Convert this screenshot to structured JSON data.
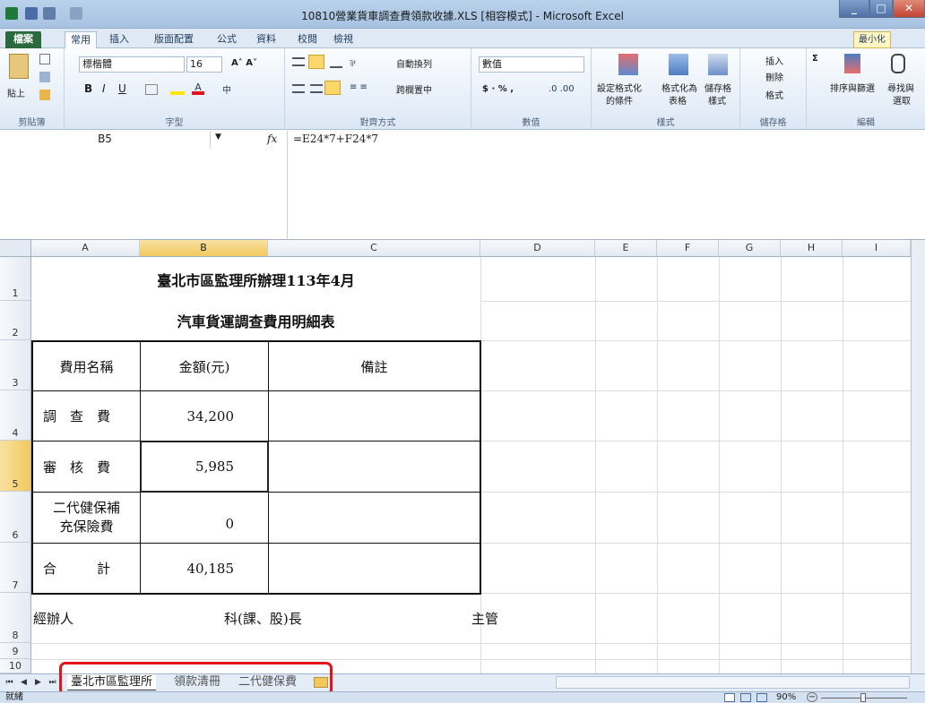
{
  "window": {
    "title": "10810營業貨車調查費領款收據.XLS [相容模式] - Microsoft Excel"
  },
  "tabs": {
    "file": "檔案",
    "home": "常用",
    "insert": "插入",
    "layout": "版面配置",
    "formulas": "公式",
    "data": "資料",
    "review": "校閱",
    "view": "檢視",
    "minimize": "最小化"
  },
  "ribbon": {
    "paste": "貼上",
    "clipboard": "剪貼簿",
    "font_name": "標楷體",
    "font_size": "16",
    "font_group": "字型",
    "wrap_text": "自動換列",
    "merge_center": "跨欄置中",
    "align_group": "對齊方式",
    "number_format": "數值",
    "number_group": "數值",
    "cond_fmt_1": "設定格式化",
    "cond_fmt_2": "的條件",
    "fmt_table_1": "格式化為",
    "fmt_table_2": "表格",
    "cell_style_1": "儲存格",
    "cell_style_2": "樣式",
    "styles_group": "樣式",
    "insert": "插入",
    "delete": "刪除",
    "format": "格式",
    "cells_group": "儲存格",
    "sort_1": "排序與篩選",
    "find_1": "尋找與",
    "find_2": "選取",
    "edit_group": "編輯"
  },
  "formula_bar": {
    "name_box": "B5",
    "fx": "fx",
    "formula": "=E24*7+F24*7"
  },
  "columns": [
    "A",
    "B",
    "C",
    "D",
    "E",
    "F",
    "G",
    "H",
    "I"
  ],
  "rows": [
    "1",
    "2",
    "3",
    "4",
    "5",
    "6",
    "7",
    "8",
    "9",
    "10"
  ],
  "sheet": {
    "title1": "臺北市區監理所辦理113年4月",
    "title2": "汽車貨運調查費用明細表",
    "h_name": "費用名稱",
    "h_amount": "金額(元)",
    "h_note": "備註",
    "r1_name": "調　查　費",
    "r1_amount": "34,200",
    "r2_name": "審　核　費",
    "r2_amount": "5,985",
    "r3_name_1": "二代健保補",
    "r3_name_2": "充保險費",
    "r3_amount": "0",
    "r4_name": "合　　　計",
    "r4_amount": "40,185",
    "sign1": "經辦人",
    "sign2": "科(課、股)長",
    "sign3": "主管"
  },
  "sheet_tabs": [
    "臺北市區監理所",
    "領款清冊",
    "二代健保費"
  ],
  "status": {
    "ready": "就緒",
    "zoom": "90%"
  }
}
